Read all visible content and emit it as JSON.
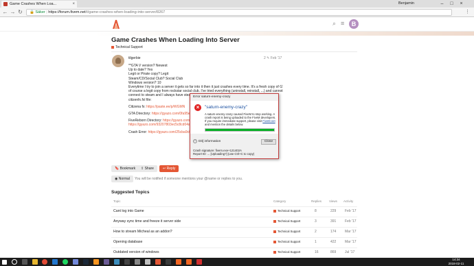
{
  "browser": {
    "tab_title": "Game Crashes When Loa...",
    "user_label": "Benjamin",
    "url_secure_label": "Säker",
    "url_host": "https://forum.fivem.net",
    "url_path": "/t/game-crashes-when-loading-into-server/8267"
  },
  "topic": {
    "title": "Game Crashes When Loading Into Server",
    "category": "Technical Support",
    "category_color": "#e45735"
  },
  "post": {
    "username": "tilgerbie",
    "edit_count": "2",
    "date": "Feb '17",
    "body_lines": [
      "**GTA V version? Newest",
      "Up to date? Yes",
      "Legit or Pirate copy? Legit",
      "Steam/CD/Social Club? Social Club",
      "Windows version? 10",
      "Everytime I try to join a server it gets so far into it then it just crashes every time. It's a fresh copy of GTA 5 and",
      "of course a legit copy from rockstar social club. I've tried everything (uninstall, reinstall, ...) and cannot",
      "connect to steam and I always have steam open... I have provided my",
      "citizenfx.fxl file:"
    ],
    "citizen_label": "Citizena fx:",
    "citizen_link": "https://paste.ee/p/WGMN",
    "gta_label": "GTA Directory:",
    "gta_link": "https://gyazo.com/0fa95e9880...",
    "fivem_label": "FiveReborn Directory:",
    "fivem_link1": "https://gyazo.com/93d...",
    "fivem_link2": "https://gyazo.com/93207803ec5c8cd04ac...",
    "crash_label": "Crash Error:",
    "crash_link": "https://gyazo.com/25cba9c0249..."
  },
  "actions": {
    "bookmark": "Bookmark",
    "share": "Share",
    "reply": "Reply",
    "notification": "Normal",
    "notification_text": "You will be notified if someone mentions your @name or replies to you."
  },
  "suggested": {
    "heading": "Suggested Topics",
    "columns": [
      "Topic",
      "Category",
      "Replies",
      "Views",
      "Activity"
    ],
    "rows": [
      {
        "title": "Cant log into Game",
        "category": "Technical Support",
        "replies": "8",
        "views": "229",
        "activity": "Feb '17"
      },
      {
        "title": "Anyway sync time and freeze it server side",
        "category": "Technical Support",
        "replies": "3",
        "views": "391",
        "activity": "Feb '17"
      },
      {
        "title": "How to stream Micheal as an addon?",
        "category": "Technical Support",
        "replies": "2",
        "views": "174",
        "activity": "Mar '17"
      },
      {
        "title": "Opening database",
        "category": "Technical Support",
        "replies": "1",
        "views": "422",
        "activity": "Mar '17"
      },
      {
        "title": "Outdated version of windows",
        "category": "Technical Support",
        "replies": "16",
        "views": "869",
        "activity": "Jul '17"
      }
    ]
  },
  "dialog": {
    "window_title": "Error saturn-enemy-crazy",
    "heading": "\"saturn-enemy-crazy\"",
    "text": "A saturn-enemy-crazy caused FiveM to stop working. A crash report is being uploaded to the FiveM developers. If you require immediate support, please visit",
    "text_link": "FiveM.net",
    "text_tail": "and mention the details below.",
    "progress": 1.0,
    "details_label": "Dit] information",
    "close_label": "Close",
    "footer_line1": "Crash signature: fivem.exe+121402A",
    "footer_line2": "Report ID: ... [Uploading?] (use Ctrl+C to copy)"
  },
  "taskbar": {
    "time": "14:34",
    "date": "2018-02-11"
  }
}
